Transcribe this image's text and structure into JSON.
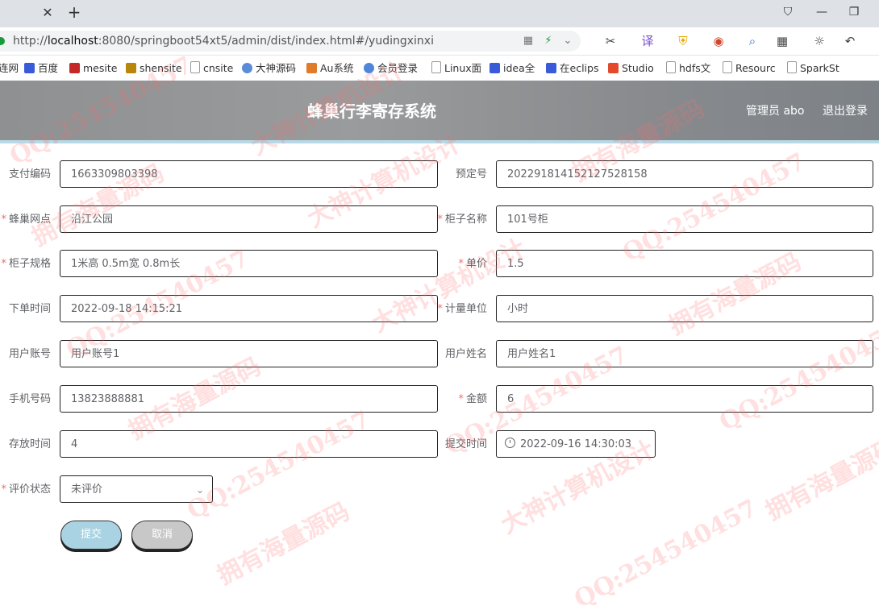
{
  "browser": {
    "url_prefix": "http://",
    "url_host": "localhost",
    "url_rest": ":8080/springboot54xt5/admin/dist/index.html#/yudingxinxi",
    "bookmarks": [
      "连网",
      "百度",
      "mesite",
      "shensite",
      "cnsite",
      "大神源码",
      "Au系统",
      "会员登录",
      "Linux面",
      "idea全",
      "在eclips",
      "Studio",
      "hdfs文",
      "Resourc",
      "SparkSt"
    ]
  },
  "header": {
    "title": "蜂巢行李寄存系统",
    "admin": "管理员 abo",
    "logout": "退出登录"
  },
  "form": {
    "pay_code": {
      "label": "支付编码",
      "value": "1663309803398"
    },
    "booking_no": {
      "label": "预定号",
      "value": "202291814152127528158"
    },
    "outlet": {
      "label": "蜂巢网点",
      "value": "沿江公园"
    },
    "cabinet_name": {
      "label": "柜子名称",
      "value": "101号柜"
    },
    "cabinet_spec": {
      "label": "柜子规格",
      "value": "1米高 0.5m宽 0.8m长"
    },
    "unit_price": {
      "label": "单价",
      "value": "1.5"
    },
    "order_time": {
      "label": "下单时间",
      "value": "2022-09-18 14:15:21"
    },
    "unit": {
      "label": "计量单位",
      "value": "小时"
    },
    "user_account": {
      "label": "用户账号",
      "value": "用户账号1"
    },
    "user_name": {
      "label": "用户姓名",
      "value": "用户姓名1"
    },
    "phone": {
      "label": "手机号码",
      "value": "13823888881"
    },
    "amount": {
      "label": "金额",
      "value": "6"
    },
    "duration": {
      "label": "存放时间",
      "value": "4"
    },
    "submit_time": {
      "label": "提交时间",
      "value": "2022-09-16 14:30:03"
    },
    "review_status": {
      "label": "评价状态",
      "value": "未评价"
    },
    "submit_btn": "提交",
    "cancel_btn": "取消"
  },
  "watermarks": [
    "QQ:254540457",
    "大神计算机设计",
    "拥有海量源码"
  ],
  "colors": {
    "required": "#f56c6c",
    "submit": "#a9d3e3",
    "cancel": "#c8c8c8",
    "header_border": "#b7d9e6"
  }
}
